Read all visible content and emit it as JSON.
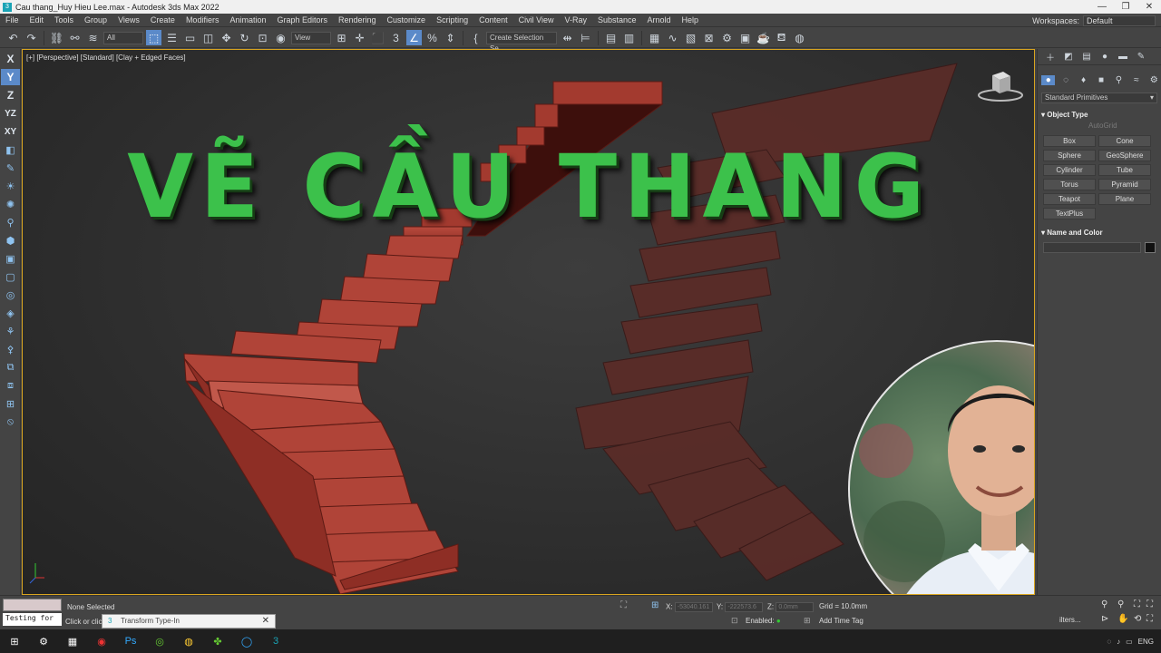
{
  "window": {
    "title": "Cau thang_Huy Hieu Lee.max - Autodesk 3ds Max 2022",
    "controls": [
      "—",
      "❐",
      "✕"
    ]
  },
  "menu": {
    "items": [
      "File",
      "Edit",
      "Tools",
      "Group",
      "Views",
      "Create",
      "Modifiers",
      "Animation",
      "Graph Editors",
      "Rendering",
      "Customize",
      "Scripting",
      "Content",
      "Civil View",
      "V-Ray",
      "Substance",
      "Arnold",
      "Help"
    ],
    "workspaces_label": "Workspaces:",
    "workspace_value": "Default"
  },
  "toolbar": {
    "filter_value": "All",
    "view_value": "View",
    "selection_set_value": "Create Selection Se"
  },
  "left_tools": {
    "axis_labels": [
      "X",
      "Y",
      "Z",
      "YZ",
      "XY"
    ]
  },
  "viewport": {
    "label": "[+] [Perspective] [Standard] [Clay + Edged Faces]",
    "headline": "VẼ CẦU THANG",
    "stair_color": "#a33a2f",
    "stair_ghost_color": "#5a2c28"
  },
  "command_panel": {
    "dropdown_value": "Standard Primitives",
    "object_type_title": "Object Type",
    "autogrid_label": "AutoGrid",
    "object_buttons": [
      "Box",
      "Cone",
      "Sphere",
      "GeoSphere",
      "Cylinder",
      "Tube",
      "Torus",
      "Pyramid",
      "Teapot",
      "Plane",
      "TextPlus"
    ],
    "name_color_title": "Name and Color"
  },
  "status": {
    "maxscript_input": "Testing for",
    "selection_status": "None Selected",
    "prompt": "Click or click",
    "transform_dialog_title": "Transform Type-In",
    "x_label": "X:",
    "x_value": "-53040.161",
    "y_label": "Y:",
    "y_value": "-222573.6",
    "z_label": "Z:",
    "z_value": "0.0mm",
    "grid": "Grid = 10.0mm",
    "enabled_label": "Enabled:",
    "add_time_tag": "Add Time Tag",
    "filters_label": "ilters..."
  },
  "taskbar": {
    "language": "ENG"
  }
}
